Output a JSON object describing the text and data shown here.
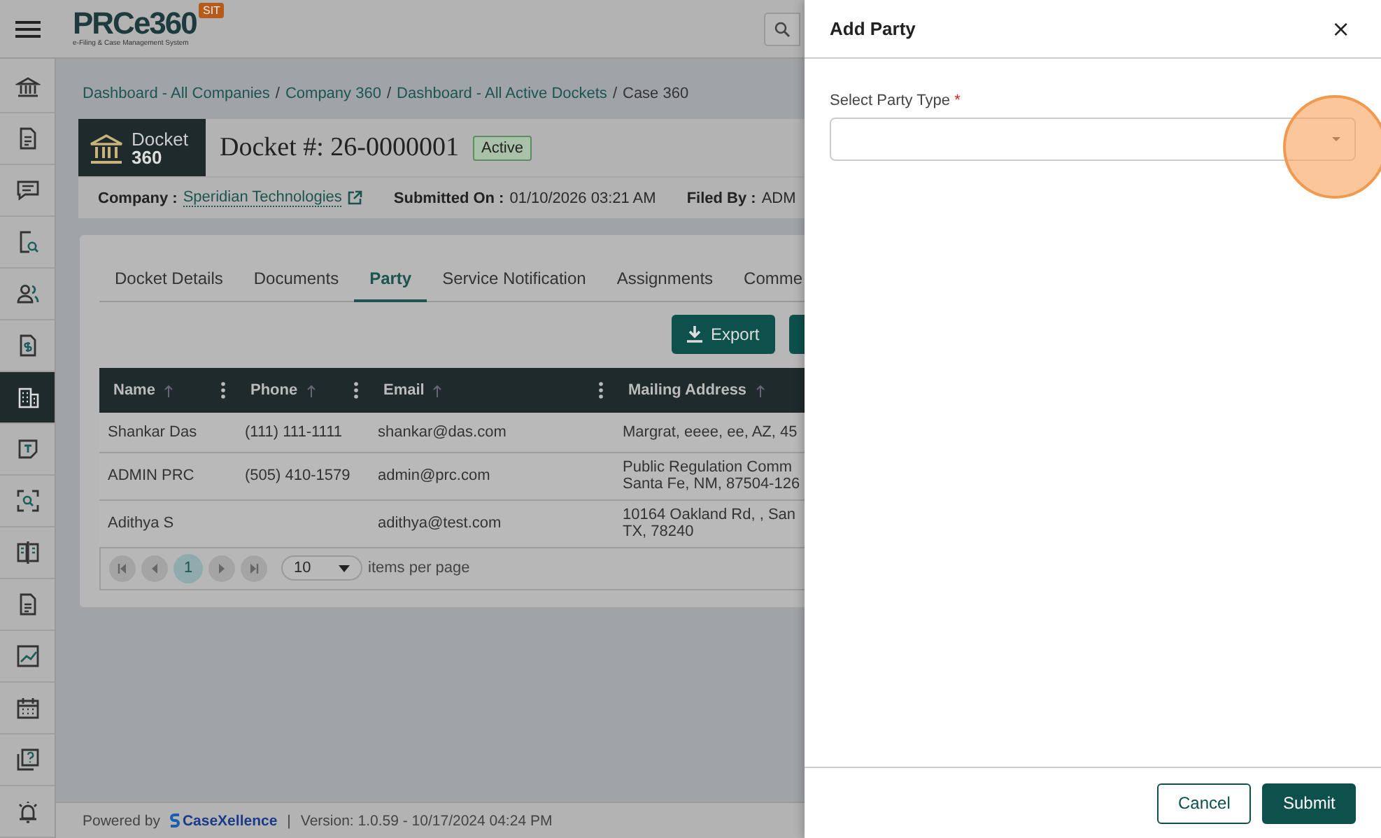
{
  "header": {
    "logo": "PRCe360",
    "logo_subtitle": "e-Filing & Case Management System",
    "env_badge": "SIT"
  },
  "sidebar": {
    "items": [
      {
        "selected": false
      },
      {
        "selected": false
      },
      {
        "selected": false
      },
      {
        "selected": false
      },
      {
        "selected": false
      },
      {
        "selected": false
      },
      {
        "selected": true
      },
      {
        "selected": false
      },
      {
        "selected": false
      },
      {
        "selected": false
      },
      {
        "selected": false
      },
      {
        "selected": false
      },
      {
        "selected": false
      },
      {
        "selected": false
      },
      {
        "selected": false
      }
    ]
  },
  "breadcrumb": [
    {
      "label": "Dashboard - All Companies",
      "link": true
    },
    {
      "separator_before": "/",
      "label": "Company 360",
      "link": true
    },
    {
      "separator_before": "/",
      "label": "Dashboard - All Active Dockets",
      "link": true
    },
    {
      "separator_before": "/",
      "label": "Case 360",
      "link": false
    }
  ],
  "docket": {
    "brand_line1": "Docket",
    "brand_line2": "360",
    "title": "Docket #: 26-0000001",
    "status": "Active"
  },
  "meta": [
    {
      "label": "Company :",
      "value": "Speridian Technologies",
      "kind": "link"
    },
    {
      "label": "Submitted On :",
      "value": "01/10/2026 03:21 AM",
      "kind": "text"
    },
    {
      "label": "Filed By :",
      "value": "ADM",
      "kind": "text"
    }
  ],
  "tabs": [
    {
      "label": "Docket Details",
      "selected": false
    },
    {
      "label": "Documents",
      "selected": false
    },
    {
      "label": "Party",
      "selected": true
    },
    {
      "label": "Service Notification",
      "selected": false
    },
    {
      "label": "Assignments",
      "selected": false
    },
    {
      "label": "Comme",
      "selected": false
    }
  ],
  "actions": [
    {
      "label": "Export",
      "kind": "export"
    },
    {
      "kind": "partial"
    }
  ],
  "table": {
    "columns": [
      {
        "label": "Name",
        "menu": true
      },
      {
        "label": "Phone",
        "menu": true
      },
      {
        "label": "Email",
        "menu": true
      },
      {
        "label": "Mailing Address",
        "menu": false
      }
    ],
    "rows": [
      {
        "name": "Shankar Das",
        "phone": "(111) 111-1111",
        "email": "shankar@das.com",
        "address_lines": [
          "Margrat, eeee, ee, AZ, 45"
        ]
      },
      {
        "name": "ADMIN PRC",
        "phone": "(505) 410-1579",
        "email": "admin@prc.com",
        "address_lines": [
          "Public Regulation Comm",
          "Santa Fe, NM, 87504-126"
        ]
      },
      {
        "name": "Adithya S",
        "email": "adithya@test.com",
        "address_lines": [
          "10164 Oakland Rd, , San",
          "TX, 78240"
        ]
      }
    ]
  },
  "pager": {
    "pages": [
      {
        "label": "1",
        "selected": true
      }
    ],
    "page_size": "10",
    "page_size_label": "items per page"
  },
  "footer": {
    "powered_by": "Powered by",
    "brand": "CaseXellence",
    "separator": "|",
    "version": "Version: 1.0.59 - 10/17/2024 04:24 PM"
  },
  "drawer": {
    "title": "Add Party",
    "close": "×",
    "fields": [
      {
        "label": "Select Party Type",
        "required_mark": "*",
        "highlighted": true
      }
    ],
    "buttons": [
      {
        "label": "Cancel",
        "kind": "secondary"
      },
      {
        "label": "Submit",
        "kind": "primary"
      }
    ]
  }
}
